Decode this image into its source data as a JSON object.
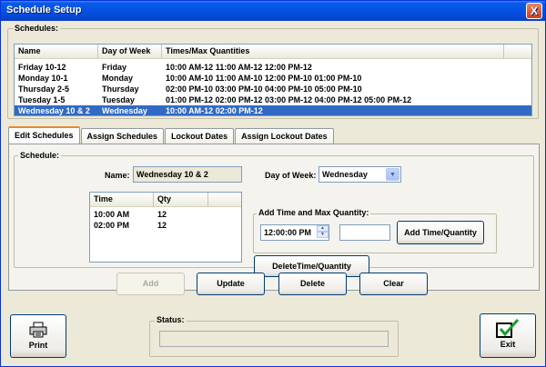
{
  "window": {
    "title": "Schedule Setup",
    "close_symbol": "X"
  },
  "schedules": {
    "label": "Schedules:",
    "columns": [
      "Name",
      "Day of Week",
      "Times/Max Quantities"
    ],
    "rows": [
      {
        "name": "Friday 10-12",
        "day": "Friday",
        "times": "10:00 AM-12  11:00 AM-12  12:00 PM-12"
      },
      {
        "name": "Monday 10-1",
        "day": "Monday",
        "times": "10:00 AM-10  11:00 AM-10  12:00 PM-10  01:00 PM-10"
      },
      {
        "name": "Thursday 2-5",
        "day": "Thursday",
        "times": "02:00 PM-10  03:00 PM-10  04:00 PM-10  05:00 PM-10"
      },
      {
        "name": "Tuesday 1-5",
        "day": "Tuesday",
        "times": "01:00 PM-12  02:00 PM-12  03:00 PM-12  04:00 PM-12  05:00 PM-12"
      },
      {
        "name": "Wednesday 10 & 2",
        "day": "Wednesday",
        "times": "10:00 AM-12  02:00 PM-12",
        "selected": true
      }
    ]
  },
  "tabs": [
    "Edit Schedules",
    "Assign Schedules",
    "Lockout Dates",
    "Assign Lockout Dates"
  ],
  "edit": {
    "schedule_label": "Schedule:",
    "name_label": "Name:",
    "name_value": "Wednesday 10 & 2",
    "day_label": "Day of Week:",
    "day_value": "Wednesday",
    "times_columns": [
      "Time",
      "Qty"
    ],
    "times_rows": [
      {
        "time": "10:00 AM",
        "qty": "12"
      },
      {
        "time": "02:00 PM",
        "qty": "12"
      }
    ],
    "add_group_label": "Add Time and Max Quantity:",
    "time_value": "12:00:00 PM",
    "qty_value": "",
    "add_time_button": "Add Time/Quantity",
    "delete_time_button": "DeleteTime/Quantity"
  },
  "actions": {
    "add": "Add",
    "update": "Update",
    "delete": "Delete",
    "clear": "Clear"
  },
  "footer": {
    "print": "Print",
    "status_label": "Status:",
    "status_value": "",
    "exit": "Exit"
  }
}
